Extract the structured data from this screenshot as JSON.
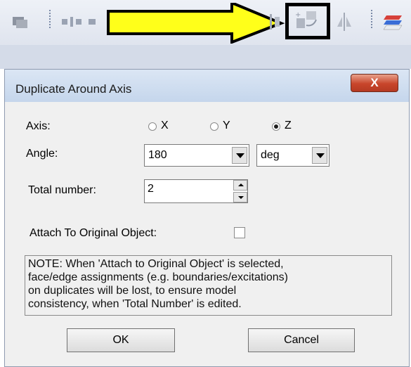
{
  "toolbar": {
    "icons": [
      "grey-square-icon",
      "grip-icon",
      "align-icon",
      "move-icon",
      "duplicate-around-axis-icon",
      "mirror-icon",
      "grip-icon",
      "layers-icon"
    ]
  },
  "dialog": {
    "title": "Duplicate Around Axis",
    "close_label": "X",
    "axis": {
      "label": "Axis:",
      "options": [
        "X",
        "Y",
        "Z"
      ],
      "selected": "Z"
    },
    "angle": {
      "label": "Angle:",
      "value": "180",
      "unit": "deg"
    },
    "total_number": {
      "label": "Total number:",
      "value": "2"
    },
    "attach": {
      "label": "Attach To Original Object:",
      "checked": false
    },
    "note_lines": [
      "NOTE:  When 'Attach to Original Object' is selected,",
      "face/edge assignments (e.g. boundaries/excitations)",
      "on duplicates will be lost, to ensure model",
      "consistency, when 'Total Number' is edited."
    ],
    "ok_label": "OK",
    "cancel_label": "Cancel"
  },
  "colors": {
    "arrow_fill": "#ffff1a",
    "highlight_box": "#000000",
    "title_bar": "#c5d6ec",
    "close_button": "#c8452b"
  }
}
